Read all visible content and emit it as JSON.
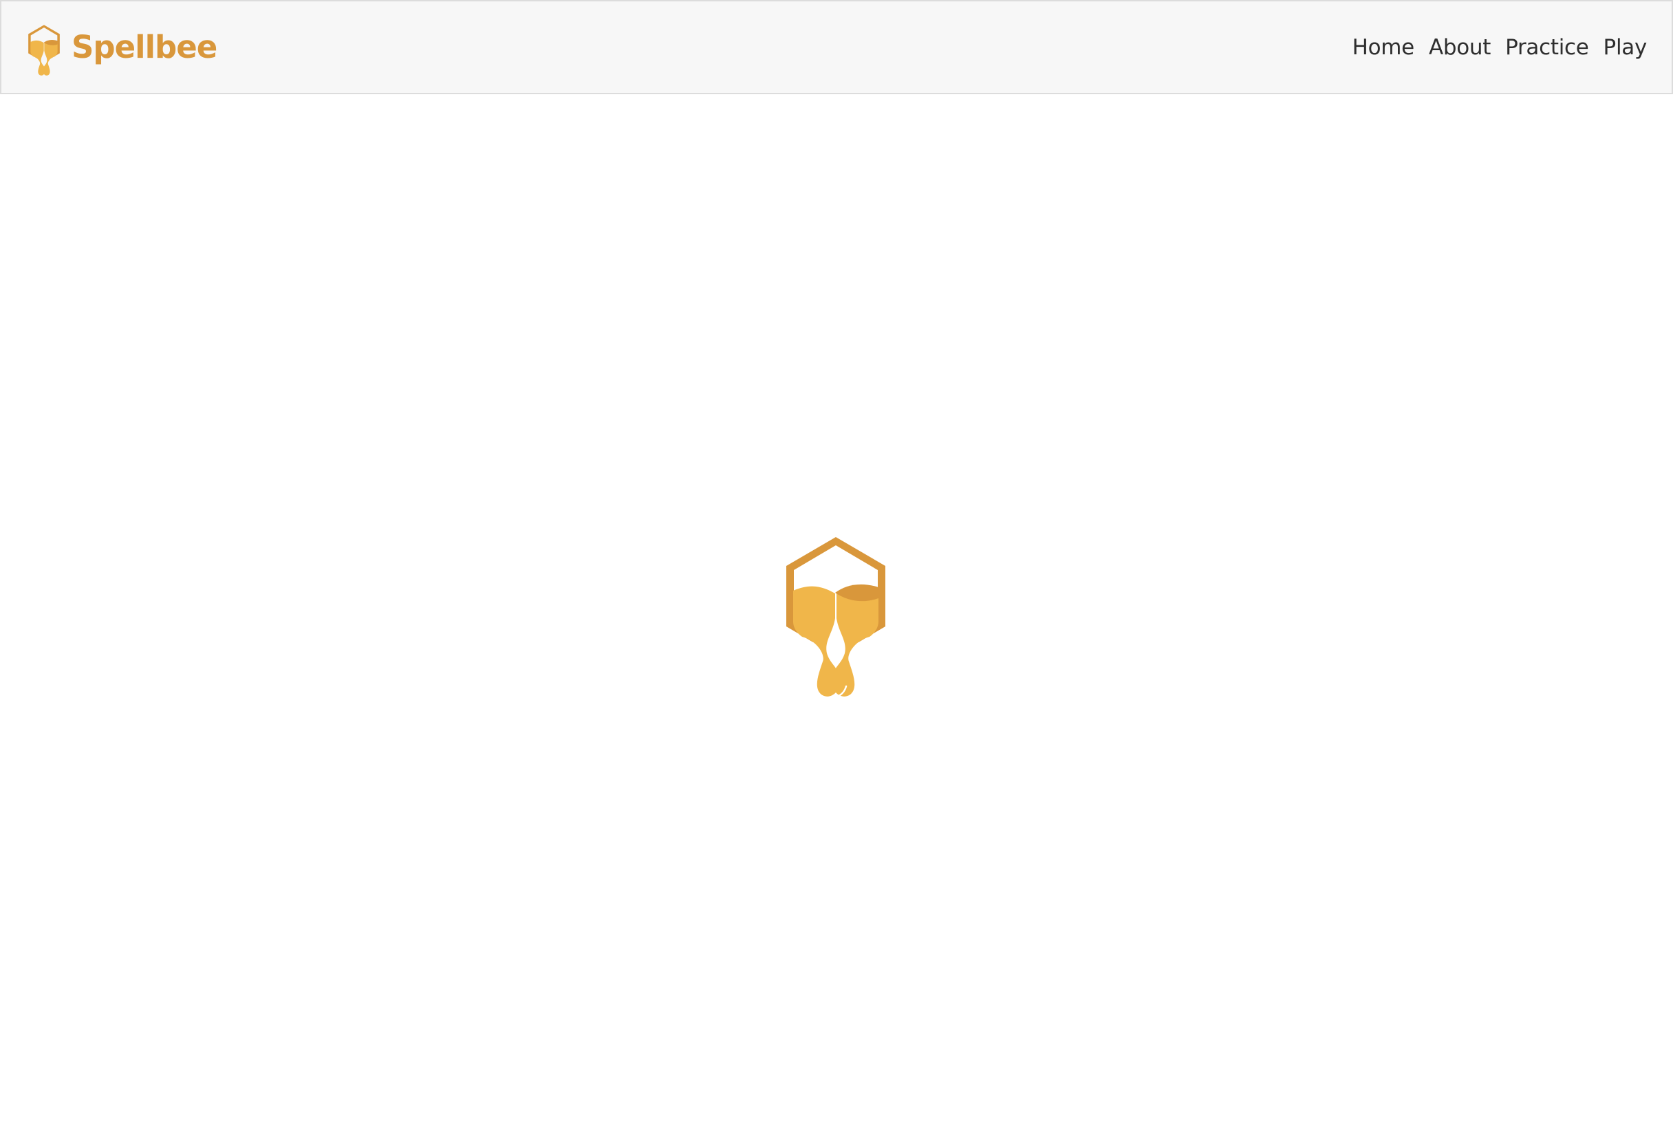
{
  "brand": {
    "name": "Spellbee",
    "logo_icon": "honeycomb-drip-icon"
  },
  "nav": {
    "items": [
      {
        "label": "Home"
      },
      {
        "label": "About"
      },
      {
        "label": "Practice"
      },
      {
        "label": "Play"
      }
    ]
  },
  "main": {
    "loader_icon": "honeycomb-drip-icon"
  },
  "colors": {
    "accent": "#d9973b",
    "honey": "#f0b64a",
    "nav_background": "#f7f7f7",
    "nav_text": "#2e2e2e"
  }
}
